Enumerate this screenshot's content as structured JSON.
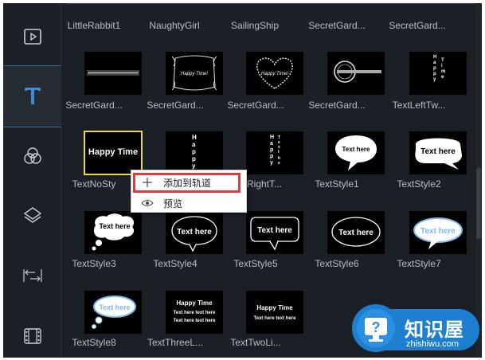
{
  "sidebar": {
    "items": [
      {
        "name": "media",
        "icon": "media-icon"
      },
      {
        "name": "text",
        "icon": "text-icon",
        "active": true
      },
      {
        "name": "filters",
        "icon": "filters-icon"
      },
      {
        "name": "overlays",
        "icon": "layers-icon"
      },
      {
        "name": "transitions",
        "icon": "transition-icon"
      },
      {
        "name": "elements",
        "icon": "film-icon"
      }
    ],
    "accent_color": "#3a8fd6"
  },
  "grid": {
    "row0": [
      "LittleRabbit1",
      "NaughtyGirl",
      "SailingShip",
      "SecretGard...",
      "SecretGard..."
    ],
    "row1": [
      "SecretGard...",
      "SecretGard...",
      "SecretGard...",
      "SecretGard...",
      "TextLeftTw..."
    ],
    "row2": [
      "TextNoSty",
      "",
      "TextRightT...",
      "TextStyle1",
      "TextStyle2"
    ],
    "row3": [
      "TextStyle3",
      "TextStyle4",
      "TextStyle5",
      "TextStyle6",
      "TextStyle7"
    ],
    "row4": [
      "TextStyle8",
      "TextThreeL...",
      "TextTwoLi..."
    ]
  },
  "thumbs": {
    "happy_time": "Happy Time",
    "happy_time_bang": "Happy Time!",
    "text_here": "Text here",
    "text_here_lines": "Text here text here",
    "happy_vertical": "Happy",
    "time_vertical": "Time"
  },
  "context_menu": {
    "add_to_track": "添加到轨道",
    "preview": "预览",
    "highlight_color": "#e23a3a"
  },
  "watermark": {
    "title": "知识屋",
    "url": "zhishiwu.com",
    "color": "#1e7fd0"
  }
}
